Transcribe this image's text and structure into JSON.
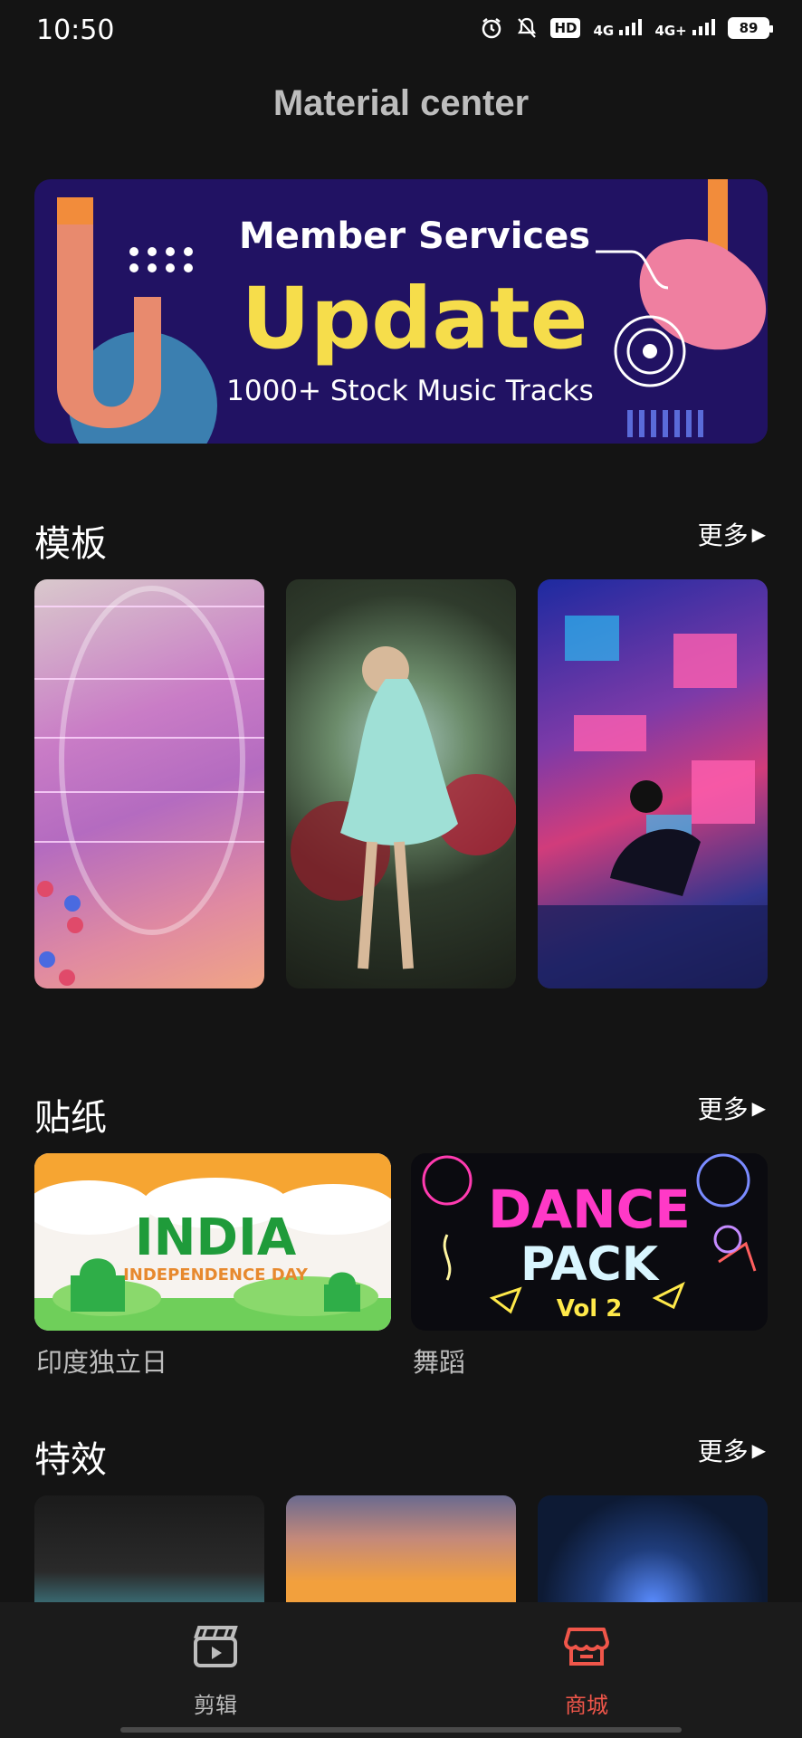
{
  "status": {
    "time": "10:50",
    "hd": "HD",
    "net1": "4G",
    "net2": "4G+",
    "battery": "89"
  },
  "page_title": "Material center",
  "banner": {
    "line1": "Member Services",
    "line2": "Update",
    "line3": "1000+ Stock Music Tracks"
  },
  "sections": {
    "templates": {
      "title": "模板",
      "more": "更多"
    },
    "stickers": {
      "title": "贴纸",
      "more": "更多",
      "items": [
        {
          "label": "印度独立日",
          "art_line1": "INDIA",
          "art_line2": "INDEPENDENCE DAY"
        },
        {
          "label": "舞蹈",
          "art_line1": "DANCE",
          "art_line2": "PACK",
          "art_line3": "Vol 2"
        }
      ]
    },
    "effects": {
      "title": "特效",
      "more": "更多"
    }
  },
  "nav": {
    "edit_label": "剪辑",
    "store_label": "商城",
    "active_color": "#f0564a"
  }
}
